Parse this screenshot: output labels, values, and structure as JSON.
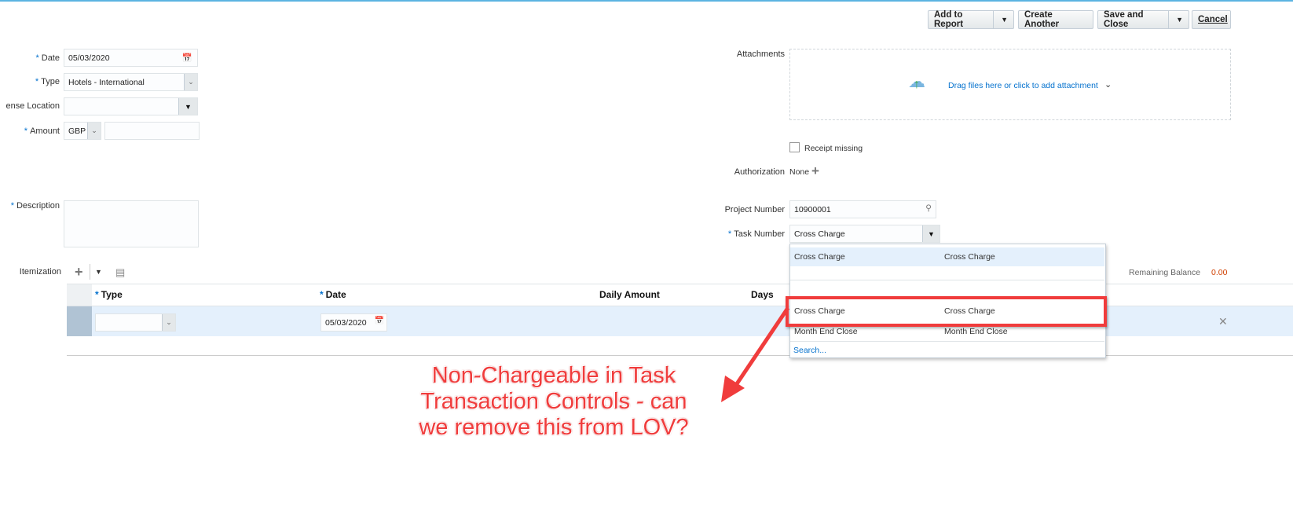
{
  "toolbar": {
    "add_to_report": "Add to Report",
    "create_another": "Create Another",
    "save_and_close": "Save and Close",
    "cancel": "Cancel"
  },
  "form": {
    "date_label": "Date",
    "date_value": "05/03/2020",
    "type_label": "Type",
    "type_value": "Hotels - International",
    "location_label": "ense Location",
    "location_value": "",
    "amount_label": "Amount",
    "currency": "GBP",
    "amount_value": "",
    "description_label": "Description",
    "attachments_label": "Attachments",
    "attachments_hint": "Drag files here or click to add attachment",
    "receipt_missing": "Receipt missing",
    "authorization_label": "Authorization",
    "authorization_value": "None",
    "project_label": "Project Number",
    "project_value": "10900001",
    "task_label": "Task Number",
    "task_value": "Cross Charge"
  },
  "lov": {
    "options": [
      {
        "a": "Cross Charge",
        "b": "Cross Charge"
      },
      {
        "a": "Cross Charge",
        "b": "Cross Charge"
      },
      {
        "a": "Month End Close",
        "b": "Month End Close"
      }
    ],
    "search": "Search..."
  },
  "itemization": {
    "label": "Itemization",
    "remaining_label": "Remaining Balance",
    "remaining_value": "0.00",
    "columns": [
      "Type",
      "Date",
      "Daily Amount",
      "Days"
    ],
    "row": {
      "type": "",
      "date": "05/03/2020"
    }
  },
  "annotation": {
    "line1": "Non-Chargeable in Task",
    "line2": "Transaction Controls - can",
    "line3": "we remove this from LOV?"
  },
  "colors": {
    "accent": "#0572ce",
    "annotation": "#f03c3c",
    "balance": "#d04000"
  }
}
